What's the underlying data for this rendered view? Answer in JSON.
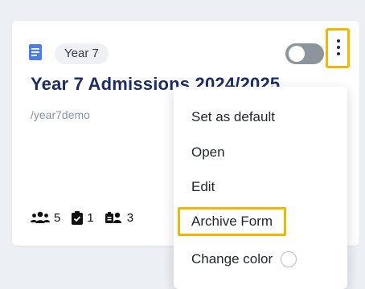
{
  "card": {
    "badge": "Year 7",
    "title": "Year 7 Admissions 2024/2025",
    "slug": "/year7demo",
    "stats": [
      {
        "icon": "users-icon",
        "value": "5"
      },
      {
        "icon": "clipboard-check-icon",
        "value": "1"
      },
      {
        "icon": "reviewers-icon",
        "value": "3"
      }
    ]
  },
  "toggle": {
    "state": "off"
  },
  "menu": {
    "items": [
      {
        "label": "Set as default"
      },
      {
        "label": "Open"
      },
      {
        "label": "Edit"
      },
      {
        "label": "Archive Form"
      },
      {
        "label": "Change color"
      }
    ]
  },
  "colors": {
    "accent_highlight": "#f2b705",
    "title": "#1d2d63",
    "doc_icon": "#4a7ee8"
  }
}
